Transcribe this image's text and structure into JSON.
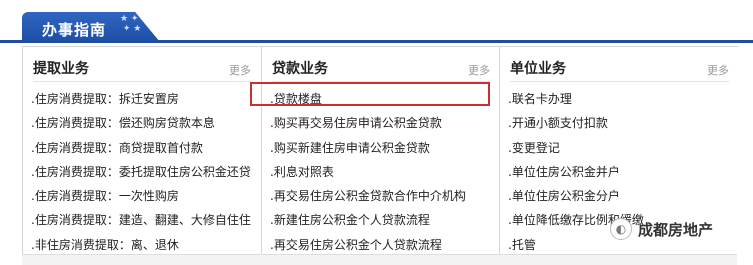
{
  "header": {
    "title": "办事指南"
  },
  "columns": [
    {
      "title": "提取业务",
      "more": "更多",
      "items": [
        ".住房消费提取：拆迁安置房",
        ".住房消费提取：偿还购房贷款本息",
        ".住房消费提取：商贷提取首付款",
        ".住房消费提取：委托提取住房公积金还贷",
        ".住房消费提取：一次性购房",
        ".住房消费提取：建造、翻建、大修自住住",
        ".非住房消费提取：离、退休"
      ]
    },
    {
      "title": "贷款业务",
      "more": "更多",
      "items": [
        ".贷款楼盘",
        ".购买再交易住房申请公积金贷款",
        ".购买新建住房申请公积金贷款",
        ".利息对照表",
        ".再交易住房公积金贷款合作中介机构",
        ".新建住房公积金个人贷款流程",
        ".再交易住房公积金个人贷款流程"
      ]
    },
    {
      "title": "单位业务",
      "more": "更多",
      "items": [
        ".联名卡办理",
        ".开通小额支付扣款",
        ".变更登记",
        ".单位住房公积金并户",
        ".单位住房公积金分户",
        ".单位降低缴存比例和缓缴",
        ".托管"
      ]
    }
  ],
  "watermark": {
    "text": "成都房地产"
  }
}
